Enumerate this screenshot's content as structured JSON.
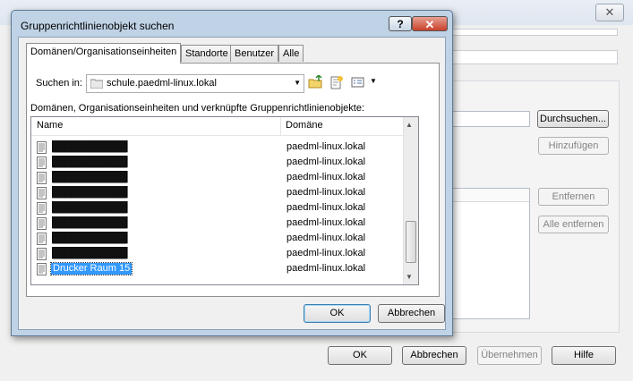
{
  "parent": {
    "buttons": {
      "browse": "Durchsuchen...",
      "add": "Hinzufügen",
      "remove": "Entfernen",
      "remove_all": "Alle entfernen",
      "ok": "OK",
      "cancel": "Abbrechen",
      "apply": "Übernehmen",
      "help": "Hilfe"
    }
  },
  "dialog": {
    "title": "Gruppenrichtlinienobjekt suchen",
    "help_glyph": "?",
    "close_glyph": "✕",
    "tabs": [
      "Domänen/Organisationseinheiten",
      "Standorte",
      "Benutzer",
      "Alle"
    ],
    "look_in_label": "Suchen in:",
    "look_in_value": "schule.paedml-linux.lokal",
    "list_caption": "Domänen, Organisationseinheiten und verknüpfte Gruppenrichtlinienobjekte:",
    "columns": [
      "Name",
      "Domäne"
    ],
    "rows": [
      {
        "name": "████████████",
        "domain": "paedml-linux.lokal",
        "selected": false
      },
      {
        "name": "████████████",
        "domain": "paedml-linux.lokal",
        "selected": false
      },
      {
        "name": "████████████",
        "domain": "paedml-linux.lokal",
        "selected": false
      },
      {
        "name": "████████████",
        "domain": "paedml-linux.lokal",
        "selected": false
      },
      {
        "name": "████████████",
        "domain": "paedml-linux.lokal",
        "selected": false
      },
      {
        "name": "████████████",
        "domain": "paedml-linux.lokal",
        "selected": false
      },
      {
        "name": "████████████",
        "domain": "paedml-linux.lokal",
        "selected": false
      },
      {
        "name": "████████████",
        "domain": "paedml-linux.lokal",
        "selected": false
      },
      {
        "name": "Drucker Raum 15",
        "domain": "paedml-linux.lokal",
        "selected": true
      }
    ],
    "ok": "OK",
    "cancel": "Abbrechen"
  }
}
